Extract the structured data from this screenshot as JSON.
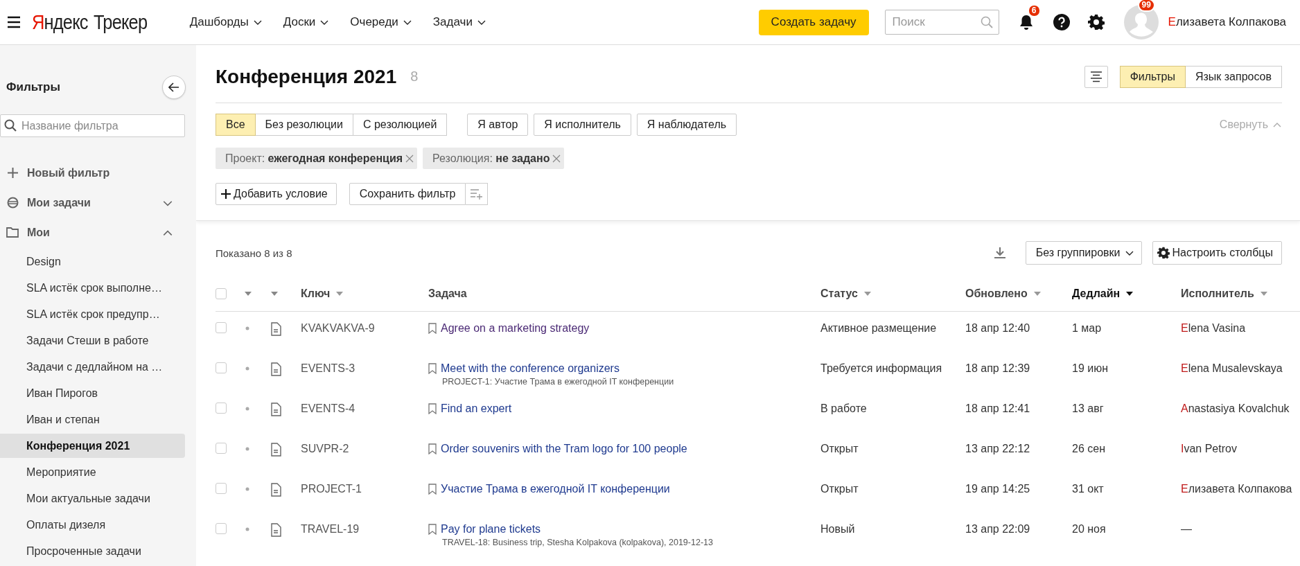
{
  "header": {
    "logo": {
      "brand": "Яндекс",
      "product": "Трекер"
    },
    "nav": [
      {
        "label": "Дашборды"
      },
      {
        "label": "Доски"
      },
      {
        "label": "Очереди"
      },
      {
        "label": "Задачи"
      }
    ],
    "create_button": "Создать задачу",
    "search": {
      "placeholder": "Поиск"
    },
    "notifications_badge": "6",
    "avatar_badge": "99",
    "user_name": "Елизавета Колпакова"
  },
  "sidebar": {
    "title": "Фильтры",
    "search": {
      "placeholder": "Название фильтра"
    },
    "items": [
      {
        "kind": "action",
        "label": "Новый фильтр"
      },
      {
        "kind": "group",
        "label": "Мои задачи",
        "expanded": false
      },
      {
        "kind": "folder",
        "label": "Мои",
        "expanded": true,
        "children": [
          {
            "label": "Design",
            "selected": false
          },
          {
            "label": "SLA истёк срок выполне…",
            "selected": false
          },
          {
            "label": "SLA истёк срок предупр…",
            "selected": false
          },
          {
            "label": "Задачи Стеши в работе",
            "selected": false
          },
          {
            "label": "Задачи с дедлайном на …",
            "selected": false
          },
          {
            "label": "Иван Пирогов",
            "selected": false
          },
          {
            "label": "Иван и степан",
            "selected": false
          },
          {
            "label": "Конференция 2021",
            "selected": true
          },
          {
            "label": "Мероприятие",
            "selected": false
          },
          {
            "label": "Мои актуальные задачи",
            "selected": false
          },
          {
            "label": "Оплаты дизеля",
            "selected": false
          },
          {
            "label": "Просроченные задачи",
            "selected": false
          }
        ]
      }
    ]
  },
  "page": {
    "title": "Конференция 2021",
    "count": "8",
    "view_toggle": [
      {
        "label": "Фильтры",
        "selected": true
      },
      {
        "label": "Язык запросов",
        "selected": false
      }
    ]
  },
  "filters": {
    "resolution_tabs": [
      {
        "label": "Все",
        "selected": true
      },
      {
        "label": "Без резолюции",
        "selected": false
      },
      {
        "label": "С резолюцией",
        "selected": false
      }
    ],
    "role_toggles": [
      {
        "label": "Я автор",
        "selected": false
      },
      {
        "label": "Я исполнитель",
        "selected": false
      },
      {
        "label": "Я наблюдатель",
        "selected": false
      }
    ],
    "collapse": "Свернуть",
    "conditions": [
      {
        "text": "Проект: **ежегодная конференция**"
      },
      {
        "text": "Резолюция: **не задано**"
      }
    ],
    "add_condition": "Добавить условие",
    "save_filter": "Сохранить фильтр"
  },
  "table": {
    "shown": "Показано 8 из 8",
    "grouping": "Без группировки",
    "columns_button": "Настроить столбцы",
    "all_checked": false,
    "columns": [
      {
        "label": "Ключ",
        "sorted": false
      },
      {
        "label": "Задача",
        "sortable": false,
        "sorted": false
      },
      {
        "label": "Статус",
        "sorted": false
      },
      {
        "label": "Обновлено",
        "sorted": false
      },
      {
        "label": "Дедлайн",
        "sorted": true
      },
      {
        "label": "Исполнитель",
        "sorted": false
      }
    ],
    "rows": [
      {
        "checked": false,
        "key": "KVAKVAKVA-9",
        "task": "Agree on a marketing strategy",
        "visited": true,
        "status": "Активное размещение",
        "updated": "18 апр 12:40",
        "deadline": "1 мар",
        "assignee": {
          "name": "Elena Vasina",
          "is_user": true
        }
      },
      {
        "checked": false,
        "key": "EVENTS-3",
        "task": "Meet with the conference organizers",
        "parent": "PROJECT-1: Участие Трама в ежегодной IT конференции",
        "visited": false,
        "status": "Требуется информация",
        "updated": "18 апр 12:39",
        "deadline": "19 июн",
        "assignee": {
          "name": "Elena Musalevskaya",
          "is_user": true
        }
      },
      {
        "checked": false,
        "key": "EVENTS-4",
        "task": "Find an expert",
        "visited": false,
        "status": "В работе",
        "updated": "18 апр 12:41",
        "deadline": "13 авг",
        "assignee": {
          "name": "Anastasiya Kovalchuk",
          "is_user": true
        }
      },
      {
        "checked": false,
        "key": "SUVPR-2",
        "task": "Order souvenirs with the Tram logo for 100 people",
        "visited": false,
        "status": "Открыт",
        "updated": "13 апр 22:12",
        "deadline": "26 сен",
        "assignee": {
          "name": "Ivan Petrov",
          "is_user": true
        }
      },
      {
        "checked": false,
        "key": "PROJECT-1",
        "task": "Участие Трама в ежегодной IT конференции",
        "visited": false,
        "status": "Открыт",
        "updated": "19 апр 14:25",
        "deadline": "31 окт",
        "assignee": {
          "name": "Елизавета Колпакова",
          "is_user": true
        }
      },
      {
        "checked": false,
        "key": "TRAVEL-19",
        "task": "Pay for plane tickets",
        "parent": "TRAVEL-18: Business trip, Stesha Kolpakova (kolpakova), 2019-12-13",
        "visited": false,
        "status": "Новый",
        "updated": "13 апр 22:09",
        "deadline": "20 ноя",
        "assignee": {
          "name": "—",
          "is_user": false
        }
      }
    ]
  }
}
